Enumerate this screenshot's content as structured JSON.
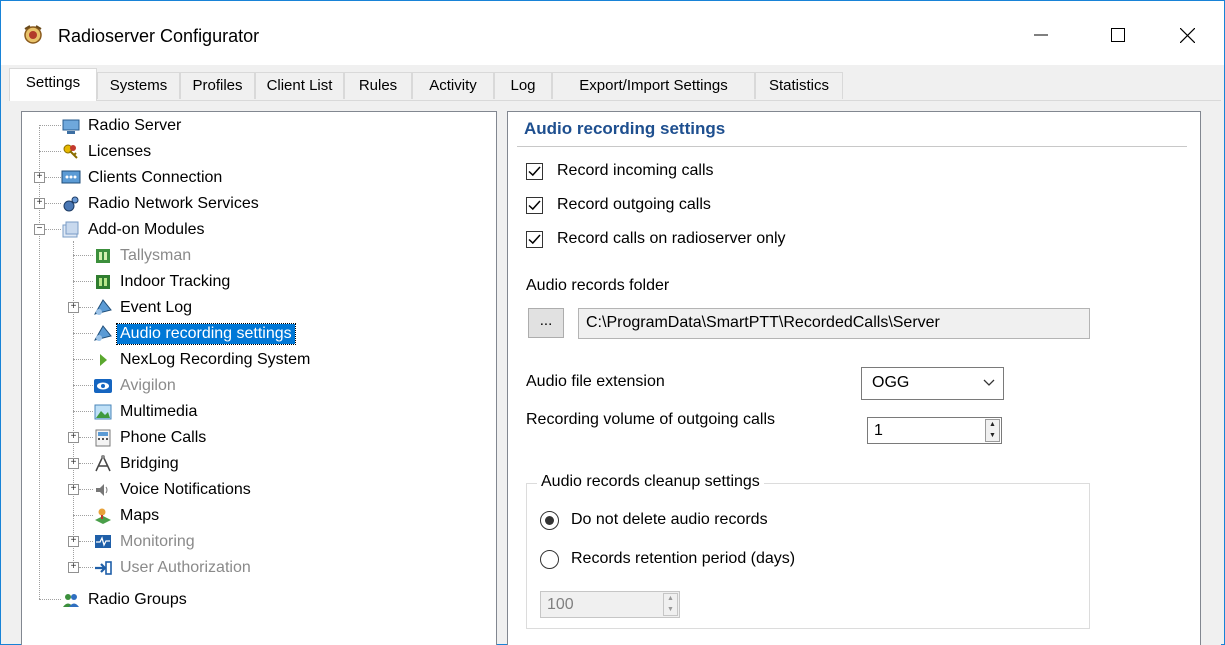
{
  "window": {
    "title": "Radioserver Configurator",
    "accent_color": "#1883d7",
    "controls": [
      "minimize-icon",
      "maximize-icon",
      "close-icon"
    ]
  },
  "tabs": [
    {
      "label": "Settings",
      "active": true
    },
    {
      "label": "Systems",
      "active": false
    },
    {
      "label": "Profiles",
      "active": false
    },
    {
      "label": "Client List",
      "active": false
    },
    {
      "label": "Rules",
      "active": false
    },
    {
      "label": "Activity",
      "active": false
    },
    {
      "label": "Log",
      "active": false
    },
    {
      "label": "Export/Import Settings",
      "active": false
    },
    {
      "label": "Statistics",
      "active": false
    }
  ],
  "tree": {
    "items": [
      {
        "label": "Radio Server",
        "icon": "server-icon",
        "level": 0,
        "expander": "none",
        "state": "normal"
      },
      {
        "label": "Licenses",
        "icon": "keys-icon",
        "level": 0,
        "expander": "none",
        "state": "normal"
      },
      {
        "label": "Clients Connection",
        "icon": "network-icon",
        "level": 0,
        "expander": "collapsed",
        "state": "normal"
      },
      {
        "label": "Radio Network Services",
        "icon": "gears-icon",
        "level": 0,
        "expander": "collapsed",
        "state": "normal"
      },
      {
        "label": "Add-on Modules",
        "icon": "modules-icon",
        "level": 0,
        "expander": "expanded",
        "state": "normal"
      },
      {
        "label": "Tallysman",
        "icon": "tallysman-icon",
        "level": 1,
        "expander": "none",
        "state": "disabled"
      },
      {
        "label": "Indoor Tracking",
        "icon": "indoor-tracking-icon",
        "level": 1,
        "expander": "none",
        "state": "normal"
      },
      {
        "label": "Event Log",
        "icon": "event-log-icon",
        "level": 1,
        "expander": "collapsed",
        "state": "normal"
      },
      {
        "label": "Audio recording settings",
        "icon": "audio-recording-icon",
        "level": 1,
        "expander": "none",
        "state": "selected"
      },
      {
        "label": "NexLog Recording System",
        "icon": "nexlog-icon",
        "level": 1,
        "expander": "none",
        "state": "normal"
      },
      {
        "label": "Avigilon",
        "icon": "avigilon-eye-icon",
        "level": 1,
        "expander": "none",
        "state": "disabled"
      },
      {
        "label": "Multimedia",
        "icon": "multimedia-icon",
        "level": 1,
        "expander": "none",
        "state": "normal"
      },
      {
        "label": "Phone Calls",
        "icon": "phone-calls-icon",
        "level": 1,
        "expander": "collapsed",
        "state": "normal"
      },
      {
        "label": "Bridging",
        "icon": "bridging-icon",
        "level": 1,
        "expander": "collapsed",
        "state": "normal"
      },
      {
        "label": "Voice Notifications",
        "icon": "speaker-icon",
        "level": 1,
        "expander": "collapsed",
        "state": "normal"
      },
      {
        "label": "Maps",
        "icon": "maps-icon",
        "level": 1,
        "expander": "none",
        "state": "normal"
      },
      {
        "label": "Monitoring",
        "icon": "monitoring-icon",
        "level": 1,
        "expander": "collapsed",
        "state": "disabled"
      },
      {
        "label": "User Authorization",
        "icon": "user-authorization-icon",
        "level": 1,
        "expander": "collapsed",
        "state": "disabled"
      },
      {
        "label": "Radio Groups",
        "icon": "radio-groups-icon",
        "level": 0,
        "expander": "none",
        "state": "normal"
      }
    ],
    "selection_color": "#0078d7"
  },
  "settings": {
    "title": "Audio recording settings",
    "title_color": "#1e4f8f",
    "record_incoming": {
      "label": "Record incoming calls",
      "checked": true
    },
    "record_outgoing": {
      "label": "Record outgoing calls",
      "checked": true
    },
    "record_server_only": {
      "label": "Record calls on radioserver only",
      "checked": true
    },
    "folder_label": "Audio records folder",
    "browse_label": "...",
    "folder_value": "C:\\ProgramData\\SmartPTT\\RecordedCalls\\Server",
    "extension_label": "Audio file extension",
    "extension_value": "OGG",
    "volume_label": "Recording volume of outgoing calls",
    "volume_value": "1",
    "cleanup": {
      "title": "Audio records cleanup settings",
      "option_keep": {
        "label": "Do not delete audio records",
        "selected": true
      },
      "option_retention": {
        "label": "Records retention period (days)",
        "selected": false
      },
      "retention_value": "100"
    }
  }
}
